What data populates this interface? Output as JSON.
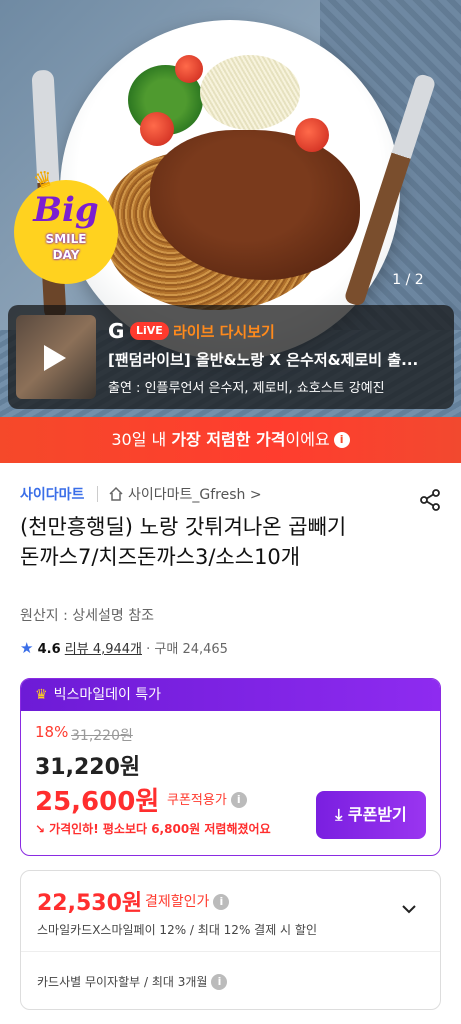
{
  "hero": {
    "badge": {
      "word": "Big",
      "line1": "SMILE",
      "line2": "DAY"
    },
    "pager": "1 / 2"
  },
  "live": {
    "brand": "G",
    "pill": "LiVE",
    "label": "라이브 다시보기",
    "title": "[팬덤라이브] 올반&노랑 X 은수저&제로비 출...",
    "cast": "출연 : 인플루언서 은수저, 제로비, 쇼호스트  강예진"
  },
  "banner": {
    "pre": "30일 내 ",
    "bold": "가장 저렴한 가격",
    "post": "이에요"
  },
  "store": {
    "name": "사이다마트",
    "sub": "사이다마트_Gfresh >"
  },
  "product": {
    "title": "(천만흥행딜) 노랑 갓튀겨나온 곱빼기돈까스7/치즈돈까스3/소스10개",
    "origin": "원산지 : 상세설명 참조",
    "rating": "4.6",
    "reviews": "리뷰 4,944개",
    "sales": "· 구매 24,465"
  },
  "promo": {
    "header": "빅스마일데이 특가",
    "discount": "18%",
    "strike_price": "31,220원",
    "orig_price": "31,220원",
    "coupon_price": "25,600원",
    "coupon_note": "쿠폰적용가",
    "lower_note": "가격인하! 평소보다 6,800원 저렴해졌어요",
    "coupon_btn": "쿠폰받기"
  },
  "payment": {
    "price": "22,530원",
    "note": "결제할인가",
    "detail": "스마일카드X스마일페이 12% / 최대 12% 결제 시 할인",
    "installment": "카드사별 무이자할부 / 최대 3개월"
  },
  "colors": {
    "accent_blue": "#3a6ee8",
    "promo_purple": "#7a1fe0",
    "sale_red": "#ff2e2e",
    "banner_orange": "#f5492a"
  }
}
